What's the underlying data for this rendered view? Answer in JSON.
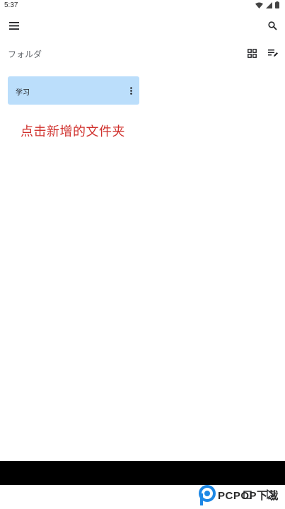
{
  "status_bar": {
    "time": "5:37"
  },
  "icons": {
    "menu": "menu-icon",
    "search": "search-icon",
    "grid": "grid-view-icon",
    "sort": "sort-edit-icon",
    "more": "more-vert-icon"
  },
  "section": {
    "title": "フォルダ"
  },
  "folders": [
    {
      "name": "学习"
    }
  ],
  "annotation": {
    "text": "点击新增的文件夹"
  },
  "watermark": {
    "brand": "PCPOP下载"
  },
  "colors": {
    "folder_card": "#bbdefb",
    "annotation": "#d0312d",
    "bottom_bar": "#000000",
    "watermark_blue": "#1e88e5"
  }
}
